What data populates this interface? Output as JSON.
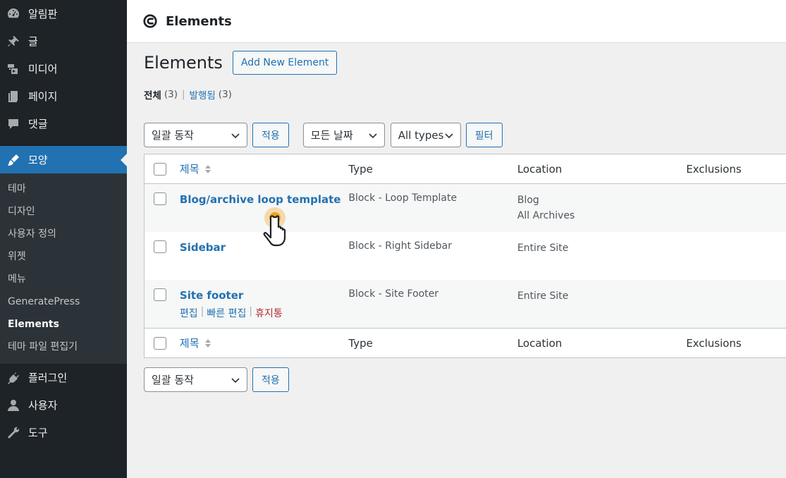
{
  "sidebar": {
    "items_top": [
      {
        "label": "알림판",
        "icon": "dashboard-icon"
      },
      {
        "label": "글",
        "icon": "pin-icon"
      },
      {
        "label": "미디어",
        "icon": "media-icon"
      },
      {
        "label": "페이지",
        "icon": "page-icon"
      },
      {
        "label": "댓글",
        "icon": "comment-icon"
      }
    ],
    "active": {
      "label": "모양",
      "icon": "brush-icon"
    },
    "submenu": [
      "테마",
      "디자인",
      "사용자 정의",
      "위젯",
      "메뉴",
      "GeneratePress",
      "Elements",
      "테마 파일 편집기"
    ],
    "items_bottom": [
      {
        "label": "플러그인",
        "icon": "plugin-icon"
      },
      {
        "label": "사용자",
        "icon": "user-icon"
      },
      {
        "label": "도구",
        "icon": "wrench-icon"
      }
    ]
  },
  "topbar": {
    "title": "Elements"
  },
  "page": {
    "title": "Elements",
    "add_button": "Add New Element",
    "filters": {
      "all_label": "전체",
      "all_count": "(3)",
      "separator": "|",
      "published_label": "발행됨",
      "published_count": "(3)"
    }
  },
  "toolbar": {
    "bulk_action": "일괄 동작",
    "apply": "적용",
    "date_filter": "모든 날짜",
    "type_filter": "All types",
    "filter_button": "필터"
  },
  "table": {
    "columns": {
      "title": "제목",
      "type": "Type",
      "location": "Location",
      "exclusions": "Exclusions"
    },
    "rows": [
      {
        "title": "Blog/archive loop template",
        "type": "Block - Loop Template",
        "location": [
          "Blog",
          "All Archives"
        ]
      },
      {
        "title": "Sidebar",
        "type": "Block - Right Sidebar",
        "location": [
          "Entire Site"
        ]
      },
      {
        "title": "Site footer",
        "type": "Block - Site Footer",
        "location": [
          "Entire Site"
        ]
      }
    ],
    "row_actions": {
      "edit": "편집",
      "quick_edit": "빠른 편집",
      "trash": "휴지통",
      "sep": "|"
    }
  },
  "colors": {
    "sidebar_bg": "#1d2327",
    "accent": "#2271b1",
    "trash": "#b32d2e",
    "cursor_highlight": "#f0a020"
  }
}
